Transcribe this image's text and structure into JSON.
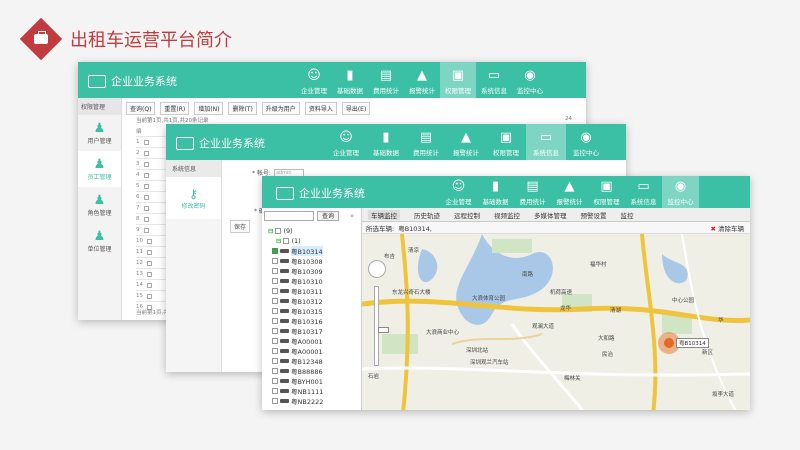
{
  "slide": {
    "title": "出租车运营平台简介"
  },
  "app_title": "企业业务系统",
  "nav": [
    "企业管理",
    "基础数据",
    "费用统计",
    "报警统计",
    "权限管理",
    "系统信息",
    "监控中心"
  ],
  "window1": {
    "sidebar_section": "权限管理",
    "menu": [
      "用户管理",
      "员工管理",
      "角色管理",
      "单位管理"
    ],
    "toolbar": [
      "查询(Q)",
      "重置(R)",
      "增加(N)",
      "删除(T)",
      "升级为用户",
      "资料导入",
      "导出(E)"
    ],
    "pagination": "当前第1页,共1页,共20条记录",
    "page_num": "24",
    "row_header": "编",
    "rows": [
      "1",
      "2",
      "3",
      "4",
      "5",
      "6",
      "7",
      "8",
      "9",
      "10",
      "11",
      "12",
      "13",
      "14",
      "15",
      "16"
    ],
    "footer": "当前第1页,共1页,共20条"
  },
  "window2": {
    "sidebar_section": "系统信息",
    "menu_item": "修改密码",
    "form_label": "* 帐号:",
    "form_value": "admin",
    "form_label2": "* 确认",
    "save_label": "保存"
  },
  "window3": {
    "tabs": [
      "车辆监控",
      "历史轨迹",
      "远程控制",
      "视频监控",
      "多媒体管理",
      "预警设置",
      "监控"
    ],
    "search_button": "查询",
    "selected_label": "所选车辆:",
    "selected_value": "粤B10314,",
    "clear_label": "清除车辆",
    "tree_root": "(9)",
    "tree_group": "(1)",
    "vehicles": [
      "粤B10314",
      "粤B10308",
      "粤B10309",
      "粤B10310",
      "粤B10311",
      "粤B10312",
      "粤B10315",
      "粤B10316",
      "粤B10317",
      "粤A00001",
      "粤A00001",
      "粤B12348",
      "粤B88886",
      "粤BYH001",
      "粤NB1111",
      "粤NB2222"
    ],
    "vehicle_marker": "粤B10314",
    "map_labels": [
      "布吉",
      "清凉",
      "东龙兴奇石大楼",
      "大浪体育公园",
      "大浪商业中心",
      "深圳北站",
      "清湖",
      "观澜大道",
      "龙华",
      "机荷高速",
      "大和路",
      "深圳观兰汽车站",
      "梅林关",
      "坂李大道",
      "中心公园",
      "民治",
      "石岩",
      "华",
      "新区",
      "南路",
      "福华村"
    ]
  }
}
